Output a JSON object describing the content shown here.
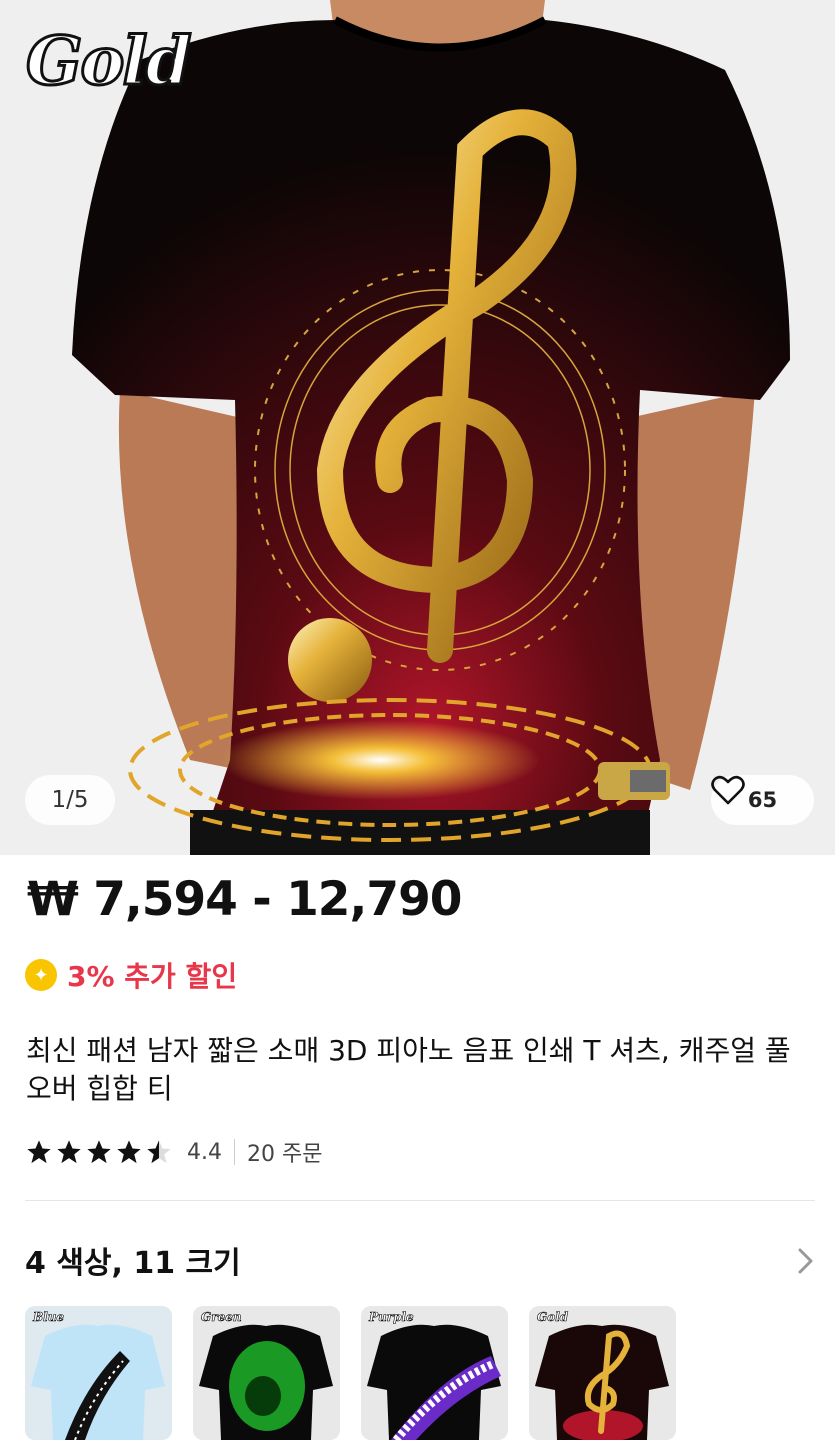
{
  "gallery": {
    "overlay_text": "Gold",
    "pager": "1/5",
    "like_count": "65",
    "icons": {
      "like": "heart-outline-icon"
    }
  },
  "product": {
    "price": "₩ 7,594 - 12,790",
    "discount": "3% 추가 할인",
    "title": "최신 패션 남자 짧은 소매 3D 피아노 음표 인쇄 T 셔츠, 캐주얼 풀오버 힙합 티",
    "rating": 4.4,
    "rating_text": "4.4",
    "orders": "20 주문",
    "variants": "4 색상, 11 크기"
  },
  "thumbnails": [
    {
      "label": "Blue",
      "shirt_color": "#bfe3f7"
    },
    {
      "label": "Green",
      "shirt_color": "#0a0a0a"
    },
    {
      "label": "Purple",
      "shirt_color": "#0a0a0a"
    },
    {
      "label": "Gold",
      "shirt_color": "#0a0a0a"
    }
  ],
  "colors": {
    "discount": "#e8364a",
    "badge": "#f9c400"
  }
}
